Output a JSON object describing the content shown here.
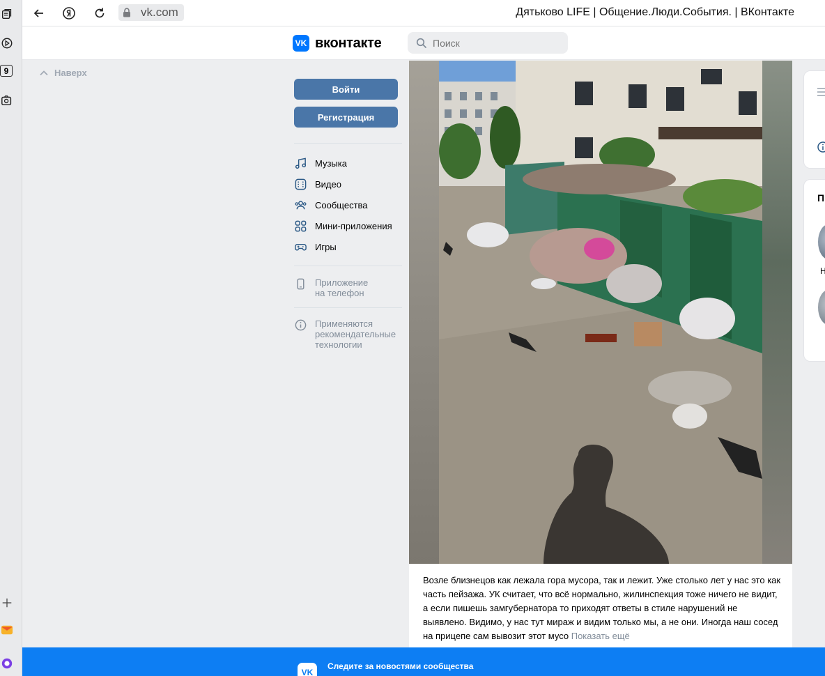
{
  "browser": {
    "url": "vk.com",
    "tab_title": "Дятьково LIFE | Общение.Люди.События. | ВКонтакте",
    "rail_badge": "9"
  },
  "header": {
    "logo_text": "вконтакте",
    "logo_mark": "VK",
    "search_placeholder": "Поиск"
  },
  "nav": {
    "up_label": "Наверх"
  },
  "auth": {
    "login_label": "Войти",
    "register_label": "Регистрация"
  },
  "menu": {
    "items": [
      {
        "label": "Музыка",
        "icon": "music-icon"
      },
      {
        "label": "Видео",
        "icon": "video-icon"
      },
      {
        "label": "Сообщества",
        "icon": "communities-icon"
      },
      {
        "label": "Мини-приложения",
        "icon": "mini-apps-icon"
      },
      {
        "label": "Игры",
        "icon": "games-icon"
      }
    ],
    "phone_app_line1": "Приложение",
    "phone_app_line2": "на телефон",
    "recs_line1": "Применяются",
    "recs_line2": "рекомендательные",
    "recs_line3": "технологии"
  },
  "post": {
    "text": "Возле близнецов как лежала гора мусора, так и лежит. Уже столько лет у нас это как часть пейзажа. УК считает, что всё нормально, жилинспекция тоже ничего не видит, а если пишешь замгубернатора то приходят ответы в стиле нарушений не выявлено. Видимо, у нас тут мираж и видим только мы, а не они. Иногда наш сосед на прицепе сам вывозит этот мусо",
    "show_more": "Показать ещё"
  },
  "right": {
    "card2_letter": "П",
    "friend1_letter": "Н"
  },
  "banner": {
    "title": "Следите за новостями сообщества",
    "logo_mark": "VK"
  },
  "colors": {
    "vk_blue": "#0077ff",
    "button_blue": "#4a76a8",
    "banner_blue": "#0d7ef3",
    "page_bg": "#edeef0"
  }
}
